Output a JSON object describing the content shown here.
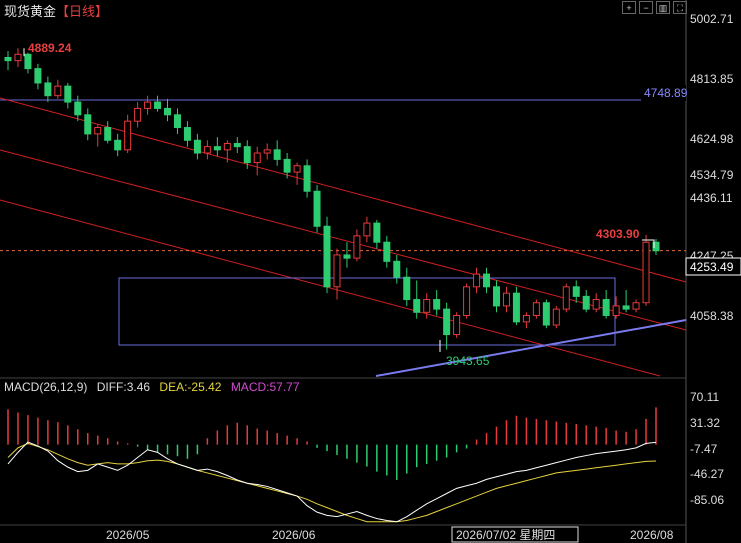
{
  "header": {
    "title": "现货黄金",
    "period": "【日线】"
  },
  "window_controls": [
    "zoom-in-icon",
    "zoom-out-icon",
    "bar-chart-icon",
    "fullscreen-icon"
  ],
  "colors": {
    "up": "#e83a3a",
    "down": "#2ecc71",
    "accent": "#ffffff"
  },
  "chart_data": [
    {
      "type": "candlestick",
      "title": "现货黄金 【日线】",
      "y_ticks": [
        "5002.71",
        "4813.85",
        "4624.98",
        "4534.79",
        "4436.11",
        "4247.25",
        "4058.38"
      ],
      "current_price": "4253.49",
      "resistance_label": "4748.89",
      "high_label": "4889.24",
      "low_label": "3943.65",
      "recent_high_label": "4303.90",
      "x_ticks": [
        "2026/05",
        "2026/06",
        "2026/07/02 星期四",
        "2026/08"
      ],
      "ylim": [
        3860,
        5002.71
      ],
      "candles": [
        [
          4860,
          4880,
          4820,
          4850
        ],
        [
          4850,
          4889,
          4830,
          4870
        ],
        [
          4870,
          4875,
          4810,
          4825
        ],
        [
          4825,
          4840,
          4760,
          4780
        ],
        [
          4780,
          4800,
          4720,
          4740
        ],
        [
          4740,
          4790,
          4730,
          4770
        ],
        [
          4770,
          4780,
          4700,
          4720
        ],
        [
          4720,
          4740,
          4660,
          4680
        ],
        [
          4680,
          4700,
          4600,
          4620
        ],
        [
          4620,
          4650,
          4580,
          4640
        ],
        [
          4640,
          4660,
          4590,
          4600
        ],
        [
          4600,
          4620,
          4550,
          4570
        ],
        [
          4570,
          4680,
          4560,
          4660
        ],
        [
          4660,
          4720,
          4640,
          4700
        ],
        [
          4700,
          4740,
          4680,
          4720
        ],
        [
          4720,
          4740,
          4690,
          4700
        ],
        [
          4700,
          4730,
          4660,
          4680
        ],
        [
          4680,
          4700,
          4620,
          4640
        ],
        [
          4640,
          4660,
          4580,
          4600
        ],
        [
          4600,
          4620,
          4540,
          4560
        ],
        [
          4560,
          4600,
          4540,
          4580
        ],
        [
          4580,
          4610,
          4550,
          4570
        ],
        [
          4570,
          4600,
          4530,
          4590
        ],
        [
          4590,
          4610,
          4560,
          4580
        ],
        [
          4580,
          4600,
          4510,
          4530
        ],
        [
          4530,
          4580,
          4490,
          4560
        ],
        [
          4560,
          4590,
          4540,
          4570
        ],
        [
          4570,
          4600,
          4520,
          4540
        ],
        [
          4540,
          4560,
          4480,
          4500
        ],
        [
          4500,
          4530,
          4460,
          4520
        ],
        [
          4520,
          4540,
          4420,
          4440
        ],
        [
          4440,
          4460,
          4310,
          4330
        ],
        [
          4330,
          4360,
          4120,
          4140
        ],
        [
          4140,
          4260,
          4100,
          4240
        ],
        [
          4240,
          4280,
          4200,
          4230
        ],
        [
          4230,
          4320,
          4220,
          4300
        ],
        [
          4300,
          4360,
          4280,
          4340
        ],
        [
          4340,
          4350,
          4260,
          4280
        ],
        [
          4280,
          4300,
          4200,
          4220
        ],
        [
          4220,
          4240,
          4150,
          4170
        ],
        [
          4170,
          4200,
          4080,
          4100
        ],
        [
          4100,
          4160,
          4040,
          4060
        ],
        [
          4060,
          4120,
          4040,
          4100
        ],
        [
          4100,
          4130,
          4050,
          4070
        ],
        [
          4070,
          4090,
          3943,
          3990
        ],
        [
          3990,
          4060,
          3980,
          4050
        ],
        [
          4050,
          4150,
          4040,
          4140
        ],
        [
          4140,
          4200,
          4120,
          4180
        ],
        [
          4180,
          4200,
          4120,
          4140
        ],
        [
          4140,
          4160,
          4060,
          4080
        ],
        [
          4080,
          4140,
          4060,
          4120
        ],
        [
          4120,
          4140,
          4020,
          4030
        ],
        [
          4030,
          4060,
          4010,
          4050
        ],
        [
          4050,
          4100,
          4040,
          4090
        ],
        [
          4090,
          4100,
          4010,
          4020
        ],
        [
          4020,
          4080,
          4010,
          4070
        ],
        [
          4070,
          4150,
          4060,
          4140
        ],
        [
          4140,
          4160,
          4090,
          4110
        ],
        [
          4110,
          4130,
          4060,
          4070
        ],
        [
          4070,
          4120,
          4060,
          4100
        ],
        [
          4100,
          4130,
          4040,
          4050
        ],
        [
          4050,
          4110,
          4040,
          4080
        ],
        [
          4080,
          4130,
          4060,
          4070
        ],
        [
          4070,
          4100,
          4060,
          4090
        ],
        [
          4090,
          4303,
          4080,
          4280
        ],
        [
          4280,
          4290,
          4240,
          4253
        ]
      ],
      "macd": {
        "legend": {
          "name": "MACD(26,12,9)",
          "diff": "DIFF:3.46",
          "dea": "DEA:-25.42",
          "macd": "MACD:57.77"
        },
        "y_ticks": [
          "70.11",
          "31.32",
          "-7.47",
          "-46.27",
          "-85.06"
        ],
        "ylim": [
          -125,
          85
        ],
        "hist": [
          55,
          50,
          46,
          42,
          38,
          35,
          30,
          24,
          18,
          14,
          10,
          5,
          2,
          -3,
          -8,
          -12,
          -15,
          -18,
          -22,
          -15,
          10,
          22,
          30,
          34,
          30,
          25,
          22,
          18,
          14,
          10,
          5,
          -5,
          -10,
          -16,
          -22,
          -28,
          -34,
          -42,
          -48,
          -55,
          -45,
          -35,
          -30,
          -25,
          -20,
          -12,
          -6,
          8,
          18,
          28,
          38,
          45,
          42,
          40,
          38,
          36,
          34,
          32,
          30,
          28,
          26,
          22,
          20,
          24,
          40,
          58
        ],
        "diff": [
          -30,
          -12,
          4,
          -2,
          -10,
          -25,
          -35,
          -42,
          -40,
          -30,
          -35,
          -40,
          -32,
          -20,
          -8,
          -12,
          -22,
          -30,
          -35,
          -40,
          -38,
          -42,
          -48,
          -55,
          -60,
          -62,
          -65,
          -70,
          -75,
          -80,
          -95,
          -105,
          -110,
          -112,
          -108,
          -104,
          -110,
          -115,
          -118,
          -120,
          -112,
          -102,
          -92,
          -84,
          -76,
          -68,
          -64,
          -60,
          -54,
          -50,
          -46,
          -42,
          -40,
          -36,
          -32,
          -28,
          -24,
          -20,
          -17,
          -14,
          -12,
          -10,
          -8,
          -5,
          2,
          3.46
        ],
        "dea": [
          -20,
          -5,
          2,
          -3,
          -8,
          -15,
          -22,
          -28,
          -32,
          -30,
          -28,
          -30,
          -30,
          -28,
          -25,
          -24,
          -26,
          -30,
          -35,
          -40,
          -44,
          -48,
          -52,
          -56,
          -60,
          -64,
          -68,
          -72,
          -76,
          -80,
          -85,
          -92,
          -98,
          -104,
          -110,
          -115,
          -120,
          -120,
          -120,
          -120,
          -118,
          -114,
          -110,
          -104,
          -98,
          -92,
          -86,
          -80,
          -74,
          -68,
          -64,
          -60,
          -56,
          -52,
          -48,
          -44,
          -42,
          -40,
          -38,
          -36,
          -34,
          -32,
          -30,
          -28,
          -26,
          -25.42
        ]
      }
    }
  ]
}
